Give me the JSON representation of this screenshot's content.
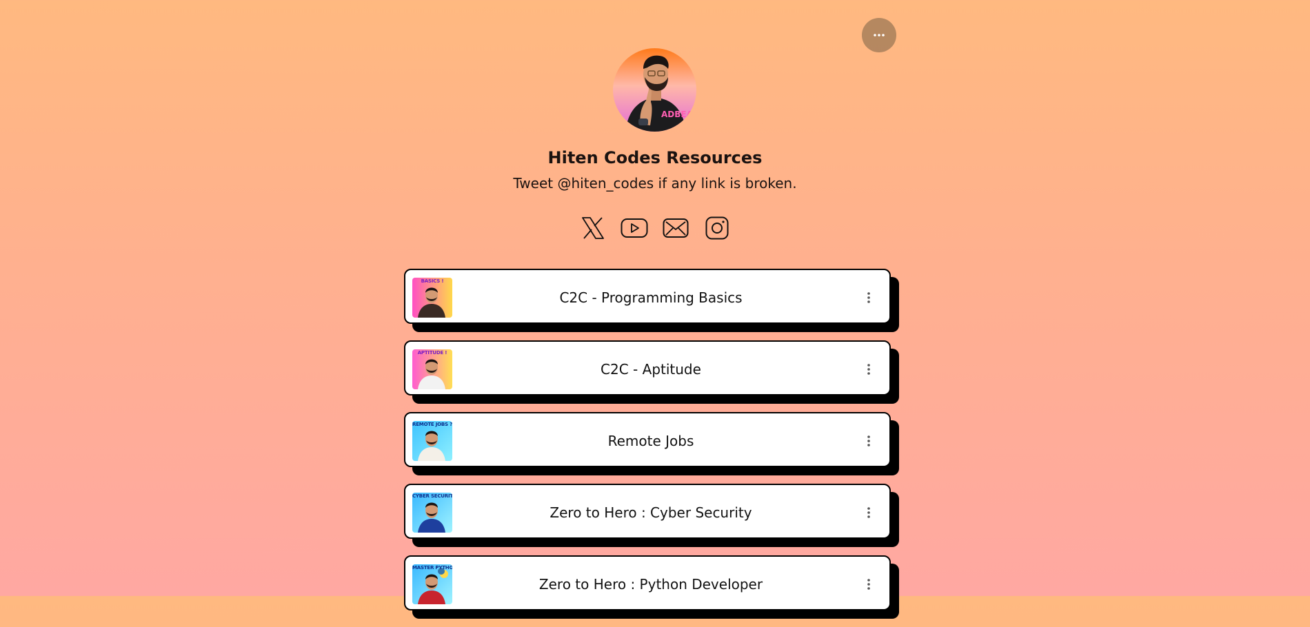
{
  "profile": {
    "name": "Hiten Codes Resources",
    "bio": "Tweet @hiten_codes if any link is broken."
  },
  "menu": {
    "icon": "more-horizontal-icon"
  },
  "socials": [
    {
      "icon": "x-twitter-icon"
    },
    {
      "icon": "youtube-icon"
    },
    {
      "icon": "email-icon"
    },
    {
      "icon": "instagram-icon"
    }
  ],
  "links": [
    {
      "label": "C2C - Programming Basics",
      "thumb_tag": "BASICS !",
      "thumb_colors": [
        "#ff4fc3",
        "#ffd84a"
      ],
      "tag_color": "#7a1dc4"
    },
    {
      "label": "C2C - Aptitude",
      "thumb_tag": "APTITUDE !",
      "thumb_colors": [
        "#ff5ccf",
        "#ffde55"
      ],
      "tag_color": "#7a1dc4"
    },
    {
      "label": "Remote Jobs",
      "thumb_tag": "REMOTE JOBS ?",
      "thumb_colors": [
        "#3ec3ff",
        "#8ff0ff"
      ],
      "tag_color": "#0d2f8c"
    },
    {
      "label": "Zero to Hero : Cyber Security",
      "thumb_tag": "CYBER SECURITY !",
      "thumb_colors": [
        "#3ab8ff",
        "#9ff3ff"
      ],
      "tag_color": "#0d2f8c"
    },
    {
      "label": "Zero to Hero : Python Developer",
      "thumb_tag": "MASTER PYTHON !",
      "thumb_colors": [
        "#3ab8ff",
        "#9ff3ff"
      ],
      "tag_color": "#0d2f8c"
    }
  ]
}
